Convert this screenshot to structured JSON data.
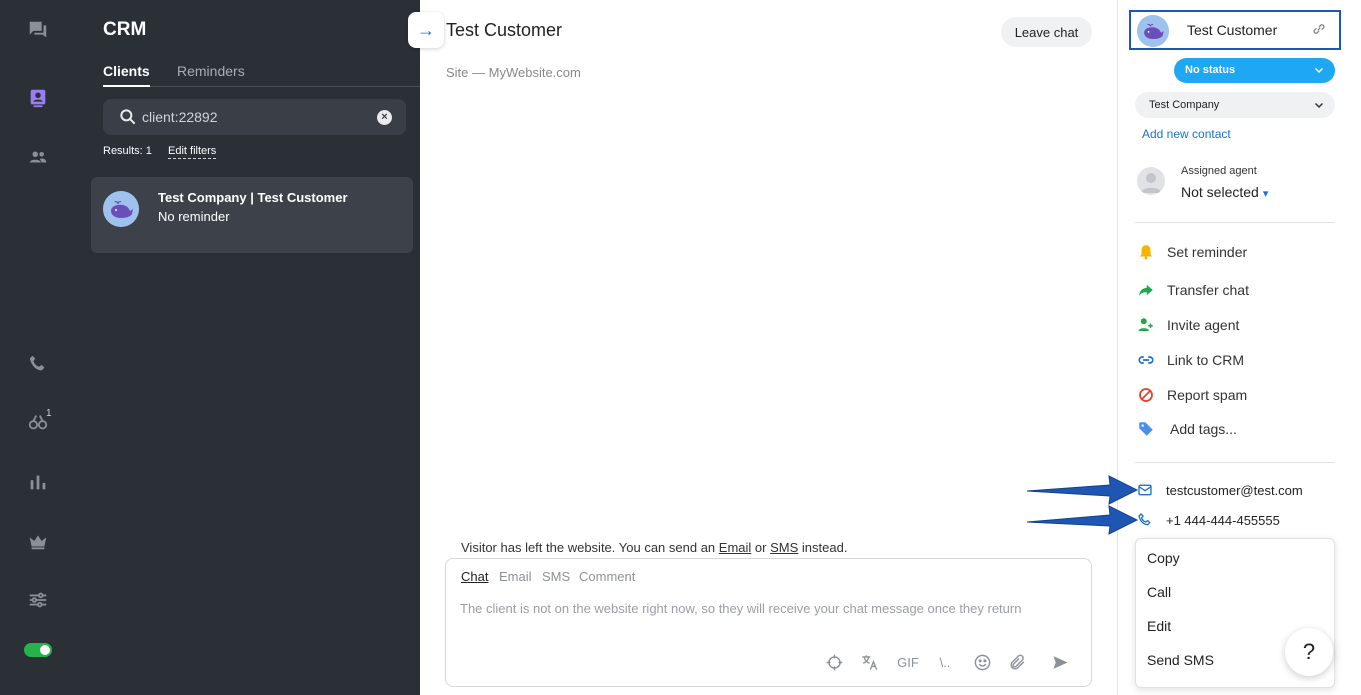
{
  "rail": {
    "active": "crm",
    "badge_count": "1"
  },
  "crm": {
    "title": "CRM",
    "tabs": [
      {
        "label": "Clients",
        "active": true
      },
      {
        "label": "Reminders",
        "active": false
      }
    ],
    "search": {
      "value": "client:22892"
    },
    "results_label": "Results: 1",
    "edit_filters_label": "Edit filters",
    "clients": [
      {
        "name": "Test Company | Test Customer",
        "reminder": "No reminder"
      }
    ]
  },
  "chat": {
    "title": "Test Customer",
    "leave_label": "Leave chat",
    "site_line": "Site — MyWebsite.com",
    "visitor_note": {
      "prefix": "Visitor has left the website. You can send an",
      "email_link": "Email",
      "middle": "or",
      "sms_link": "SMS",
      "suffix": "instead."
    },
    "composer": {
      "tabs": [
        "Chat",
        "Email",
        "SMS",
        "Comment"
      ],
      "active_tab": "Chat",
      "placeholder": "The client is not on the website right now, so they will receive your chat message once they return",
      "tools": [
        "crosshair-icon",
        "translate-icon",
        "GIF",
        "\\..",
        "emoji-icon",
        "attach-icon",
        "send-icon"
      ],
      "gif_label": "GIF",
      "shortcut_label": "\\.."
    }
  },
  "profile": {
    "name": "Test Customer",
    "status": "No status",
    "company": "Test Company",
    "add_contact": "Add new contact",
    "agent_label": "Assigned agent",
    "agent_value": "Not selected",
    "actions": [
      {
        "label": "Set reminder",
        "icon": "bell-icon",
        "color": "#f5b400"
      },
      {
        "label": "Transfer chat",
        "icon": "forward-arrow-icon",
        "color": "#1fa84a"
      },
      {
        "label": "Invite agent",
        "icon": "add-person-icon",
        "color": "#1fa84a"
      },
      {
        "label": "Link to CRM",
        "icon": "link-icon",
        "color": "#1a73c9"
      },
      {
        "label": "Report spam",
        "icon": "block-icon",
        "color": "#e0442c"
      },
      {
        "label": "Add tags...",
        "icon": "tag-icon",
        "color": "#4a8ff0"
      }
    ],
    "email": "testcustomer@test.com",
    "phone": "+1 444-444-455555",
    "context_menu": [
      "Copy",
      "Call",
      "Edit",
      "Send SMS"
    ]
  },
  "help_label": "?",
  "colors": {
    "sidebar_bg": "#2b2f36",
    "accent_blue": "#1a73c9",
    "status_blue": "#1ea7f2",
    "highlight_border": "#1e56b3",
    "online_green": "#27b34b"
  }
}
